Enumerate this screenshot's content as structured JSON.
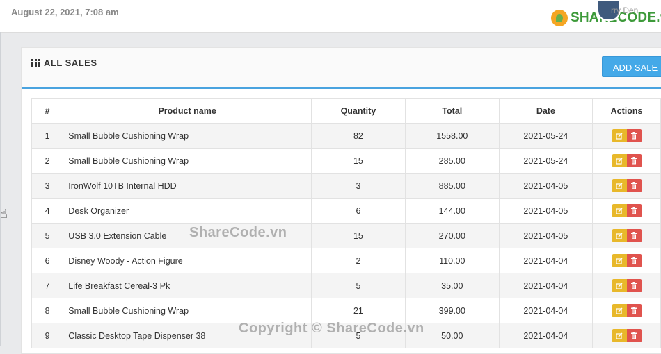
{
  "header": {
    "date": "August 22, 2021, 7:08 am",
    "user_name": "rry Den",
    "logo_text": "SHARECODE.vn"
  },
  "panel": {
    "title": "ALL SALES",
    "add_button": "ADD SALE"
  },
  "table": {
    "columns": [
      "#",
      "Product name",
      "Quantity",
      "Total",
      "Date",
      "Actions"
    ],
    "rows": [
      {
        "id": "1",
        "product": "Small Bubble Cushioning Wrap",
        "quantity": "82",
        "total": "1558.00",
        "date": "2021-05-24"
      },
      {
        "id": "2",
        "product": "Small Bubble Cushioning Wrap",
        "quantity": "15",
        "total": "285.00",
        "date": "2021-05-24"
      },
      {
        "id": "3",
        "product": "IronWolf 10TB Internal HDD",
        "quantity": "3",
        "total": "885.00",
        "date": "2021-04-05"
      },
      {
        "id": "4",
        "product": "Desk Organizer",
        "quantity": "6",
        "total": "144.00",
        "date": "2021-04-05"
      },
      {
        "id": "5",
        "product": "USB 3.0 Extension Cable",
        "quantity": "15",
        "total": "270.00",
        "date": "2021-04-05"
      },
      {
        "id": "6",
        "product": "Disney Woody - Action Figure",
        "quantity": "2",
        "total": "110.00",
        "date": "2021-04-04"
      },
      {
        "id": "7",
        "product": "Life Breakfast Cereal-3 Pk",
        "quantity": "5",
        "total": "35.00",
        "date": "2021-04-04"
      },
      {
        "id": "8",
        "product": "Small Bubble Cushioning Wrap",
        "quantity": "21",
        "total": "399.00",
        "date": "2021-04-04"
      },
      {
        "id": "9",
        "product": "Classic Desktop Tape Dispenser 38",
        "quantity": "5",
        "total": "50.00",
        "date": "2021-04-04"
      }
    ]
  },
  "watermarks": {
    "center": "ShareCode.vn",
    "bottom": "Copyright © ShareCode.vn"
  },
  "colors": {
    "add_button": "#44a9e8",
    "edit_button": "#e8b82a",
    "delete_button": "#e0534e",
    "heading_border": "#4aa3df"
  },
  "icons": {
    "panel": "grid-icon",
    "edit": "edit-icon",
    "delete": "trash-icon"
  }
}
